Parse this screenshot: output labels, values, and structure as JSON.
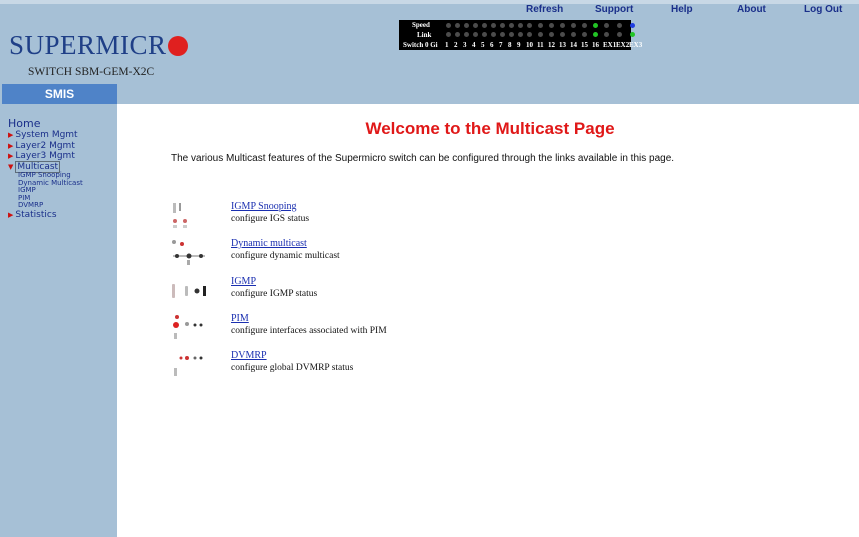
{
  "header": {
    "logo_text": "SUPERMICR",
    "model": "SWITCH SBM-GEM-X2C",
    "nav": [
      "Refresh",
      "Support",
      "Help",
      "About",
      "Log Out"
    ]
  },
  "port_panel": {
    "speed_label": "Speed",
    "link_label": "Link",
    "row_label": "Switch 0 Gi",
    "ports": [
      "1",
      "2",
      "3",
      "4",
      "5",
      "6",
      "7",
      "8",
      "9",
      "10",
      "11",
      "12",
      "13",
      "14",
      "15",
      "16",
      "EX1",
      "EX2",
      "EX3"
    ]
  },
  "sidebar": {
    "title": "SMIS",
    "home": "Home",
    "items": [
      "System Mgmt",
      "Layer2 Mgmt",
      "Layer3 Mgmt",
      "Multicast"
    ],
    "sub": [
      "IGMP Snooping",
      "Dynamic Multicast",
      "IGMP",
      "PIM",
      "DVMRP"
    ],
    "last": "Statistics"
  },
  "main": {
    "title": "Welcome to the Multicast Page",
    "intro": "The various Multicast features of the Supermicro switch can be configured through the links available in this page.",
    "features": [
      {
        "link": "IGMP Snooping",
        "desc": "configure IGS status"
      },
      {
        "link": "Dynamic multicast",
        "desc": "configure dynamic multicast"
      },
      {
        "link": "IGMP",
        "desc": "configure IGMP status"
      },
      {
        "link": "PIM",
        "desc": "configure interfaces associated with PIM"
      },
      {
        "link": "DVMRP",
        "desc": "configure global DVMRP status"
      }
    ]
  },
  "colors": {
    "accent_red": "#e01818",
    "bar_blue": "#a6c0d6",
    "led_green": "#22c425",
    "led_blue": "#1f3de0"
  }
}
